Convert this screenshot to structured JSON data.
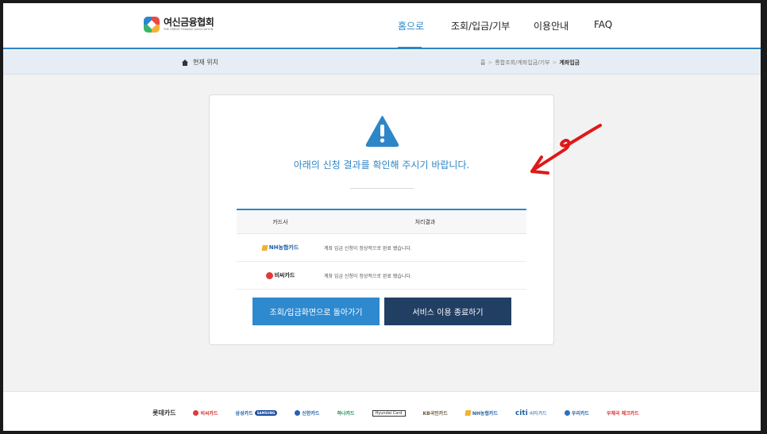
{
  "header": {
    "logo_text": "여신금융협회",
    "logo_subtext": "THE CREDIT FINANCE ASSOCIATION",
    "nav": {
      "home": "홈으로",
      "inquiry": "조회/입금/기부",
      "guide": "이용안내",
      "faq": "FAQ"
    }
  },
  "breadcrumb": {
    "location_label": "현재 위치",
    "home": "홈",
    "section": "통합조회/계좌입금/기부",
    "current": "계좌입금",
    "separator": ">"
  },
  "result": {
    "message": "아래의 신청 결과를 확인해 주시기 바랍니다.",
    "columns": {
      "company": "카드사",
      "result": "처리결과"
    },
    "rows": [
      {
        "company": "NH농협카드",
        "result": "계좌 입금 신청이 정상적으로 완료 됐습니다."
      },
      {
        "company": "비씨카드",
        "result": "계좌 입금 신청이 정상적으로 완료 됐습니다."
      }
    ],
    "buttons": {
      "back": "조회/입금화면으로 돌아가기",
      "exit": "서비스 이용 종료하기"
    }
  },
  "footer": {
    "partners": [
      "롯데카드",
      "비씨카드",
      "삼성카드",
      "SAMSUNG",
      "신한카드",
      "하나카드",
      "Hyundai Card",
      "KB국민카드",
      "NH농협카드",
      "citi",
      "씨티카드",
      "우리카드",
      "우체국 체크카드"
    ]
  },
  "colors": {
    "primary": "#2d86c7",
    "dark_button": "#213f63",
    "annotation": "#e01818"
  },
  "icons": {
    "warning": "warning-triangle-icon",
    "home": "home-icon"
  }
}
